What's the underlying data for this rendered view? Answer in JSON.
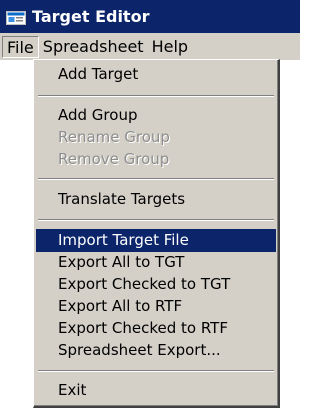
{
  "window": {
    "title": "Target Editor",
    "icon": "window-app-icon"
  },
  "menubar": {
    "items": [
      "File",
      "Spreadsheet",
      "Help"
    ]
  },
  "file_menu": {
    "items": [
      {
        "label": "Add Target",
        "enabled": true
      },
      {
        "label": "Add Group",
        "enabled": true
      },
      {
        "label": "Rename Group",
        "enabled": false
      },
      {
        "label": "Remove Group",
        "enabled": false
      },
      {
        "label": "Translate Targets",
        "enabled": true
      },
      {
        "label": "Import Target File",
        "enabled": true,
        "highlighted": true
      },
      {
        "label": "Export All to TGT",
        "enabled": true
      },
      {
        "label": "Export Checked to TGT",
        "enabled": true
      },
      {
        "label": "Export All to RTF",
        "enabled": true
      },
      {
        "label": "Export Checked to RTF",
        "enabled": true
      },
      {
        "label": "Spreadsheet Export...",
        "enabled": true
      },
      {
        "label": "Exit",
        "enabled": true
      }
    ]
  },
  "colors": {
    "highlight": "#0b246a",
    "menu_bg": "#d4d0c8",
    "disabled_text": "#8e8e8e"
  }
}
